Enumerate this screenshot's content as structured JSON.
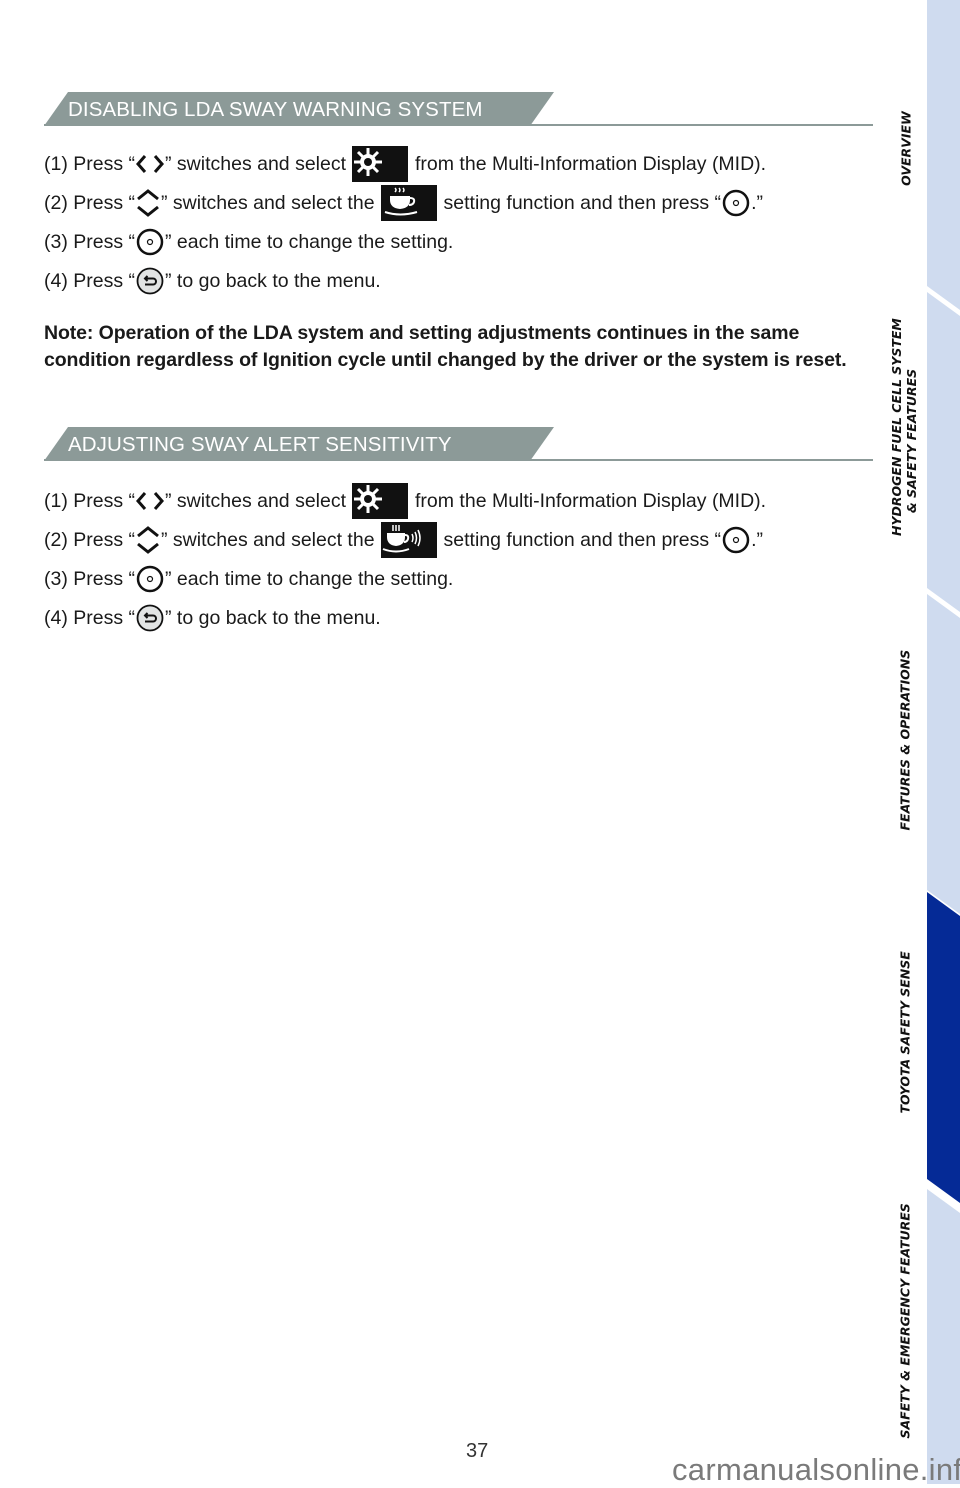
{
  "sections": [
    {
      "title": "DISABLING LDA SWAY WARNING SYSTEM",
      "steps": [
        {
          "num": "(1) Press “",
          "icon": "left-right-arrows-icon",
          "mid": " ” switches and select ",
          "icon2": "settings-gear-icon",
          "end": " from the Multi-Information Display (MID)."
        },
        {
          "num": "(2) Press “",
          "icon": "up-down-arrows-icon",
          "mid": "” switches and select the ",
          "icon2": "coffee-cup-icon",
          "end": " setting function and then press “",
          "icon3": "ok-button-icon",
          "tail": ".”"
        },
        {
          "num": "(3) Press “",
          "icon": "ok-button-icon",
          "end": "” each time to change the setting."
        },
        {
          "num": "(4) Press “",
          "icon": "back-button-icon",
          "end": "” to go back to the menu."
        }
      ]
    },
    {
      "title": "ADJUSTING SWAY ALERT SENSITIVITY",
      "steps": [
        {
          "num": "(1) Press “",
          "icon": "left-right-arrows-icon",
          "mid": " ” switches and select ",
          "icon2": "settings-gear-icon",
          "end": " from the Multi-Information Display (MID)."
        },
        {
          "num": "(2) Press “",
          "icon": "up-down-arrows-icon",
          "mid": "” switches and select the ",
          "icon2": "coffee-cup-sound-icon",
          "end": " setting function and then press “",
          "icon3": "ok-button-icon",
          "tail": ".”"
        },
        {
          "num": "(3) Press “",
          "icon": "ok-button-icon",
          "end": "” each time to change the setting."
        },
        {
          "num": "(4) Press “",
          "icon": "back-button-icon",
          "end": "” to go back to the menu."
        }
      ]
    }
  ],
  "note": "Note: Operation of the LDA system and setting adjustments continues in the same condition regardless of Ignition cycle until changed by the driver or the system is reset.",
  "sidebar": {
    "tabs": [
      {
        "label": "OVERVIEW",
        "active": false
      },
      {
        "label": "HYDROGEN FUEL CELL SYSTEM",
        "label2": "& SAFETY FEATURES",
        "active": false
      },
      {
        "label": "FEATURES & OPERATIONS",
        "active": false
      },
      {
        "label": "TOYOTA SAFETY SENSE",
        "active": true
      },
      {
        "label": "SAFETY & EMERGENCY FEATURES",
        "active": false
      }
    ],
    "colors": {
      "inactive": "#cfdbef",
      "active": "#052a96"
    }
  },
  "page_number": "37",
  "watermark": "carmanualsonline.info",
  "colors": {
    "banner": "#8c9a98",
    "text": "#1a1a1a"
  }
}
